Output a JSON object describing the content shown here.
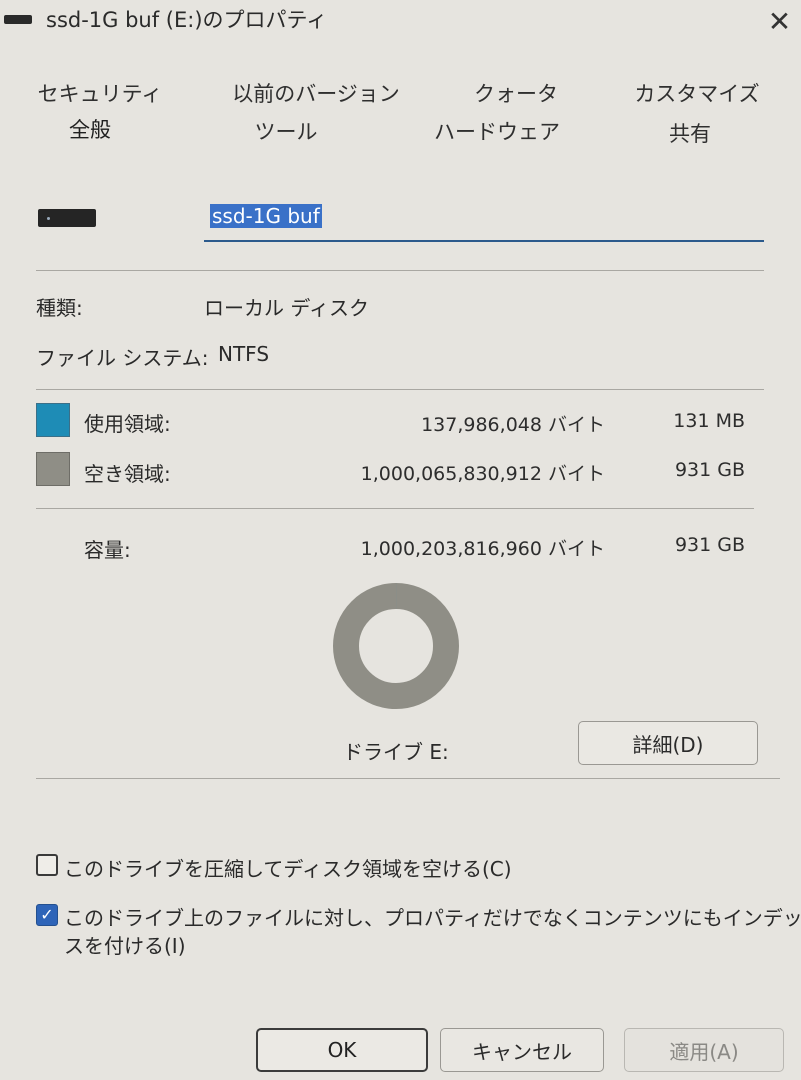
{
  "window": {
    "title": "ssd-1G buf (E:)のプロパティ",
    "close_glyph": "✕"
  },
  "tabs": [
    {
      "label": "セキュリティ"
    },
    {
      "label": "以前のバージョン"
    },
    {
      "label": "クォータ"
    },
    {
      "label": "カスタマイズ"
    },
    {
      "label": "全般",
      "active": true
    },
    {
      "label": "ツール"
    },
    {
      "label": "ハードウェア"
    },
    {
      "label": "共有"
    }
  ],
  "drive": {
    "name": "ssd-1G buf",
    "icon": "drive-icon"
  },
  "info": {
    "type_label": "種類:",
    "type_value": "ローカル ディスク",
    "fs_label": "ファイル システム:",
    "fs_value": "NTFS"
  },
  "usage": {
    "used": {
      "label": "使用領域:",
      "bytes": "137,986,048 バイト",
      "size": "131 MB",
      "color": "#1e8cb6"
    },
    "free": {
      "label": "空き領域:",
      "bytes": "1,000,065,830,912 バイト",
      "size": "931 GB",
      "color": "#8f8e86"
    },
    "capacity": {
      "label": "容量:",
      "bytes": "1,000,203,816,960 バイト",
      "size": "931 GB"
    },
    "used_fraction": 0.000138
  },
  "drive_label": "ドライブ E:",
  "details_button": "詳細(D)",
  "options": {
    "compress": {
      "label": "このドライブを圧縮してディスク領域を空ける(C)",
      "checked": false
    },
    "index": {
      "label_line1": "このドライブ上のファイルに対し、プロパティだけでなくコンテンツにもインデック",
      "label_line2": "スを付ける(I)",
      "checked": true,
      "check_glyph": "✓"
    }
  },
  "buttons": {
    "ok": "OK",
    "cancel": "キャンセル",
    "apply": "適用(A)"
  }
}
